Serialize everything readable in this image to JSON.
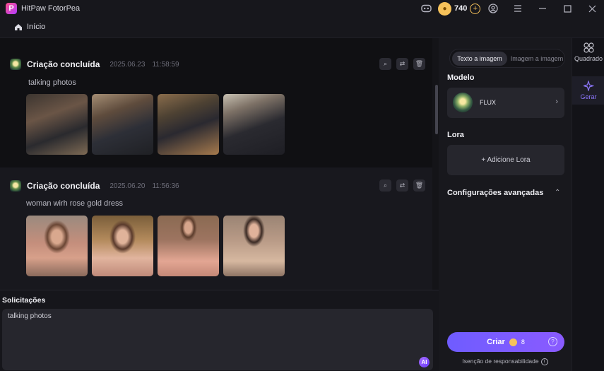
{
  "app": {
    "logo_letter": "P",
    "title": "HitPaw FotorPea"
  },
  "titlebar": {
    "coin_count": "740"
  },
  "breadcrumb": {
    "home_label": "Início"
  },
  "history": [
    {
      "title": "Criação concluída",
      "date": "2025.06.23",
      "time": "11:58:59",
      "prompt": "talking photos"
    },
    {
      "title": "Criação concluída",
      "date": "2025.06.20",
      "time": "11:56:36",
      "prompt": "woman wirh rose gold dress"
    }
  ],
  "prompt_panel": {
    "label": "Solicitações",
    "value": "talking photos",
    "ai_badge": "AI"
  },
  "settings": {
    "tabs": [
      "Texto a imagem",
      "Imagem a imagem"
    ],
    "model_label": "Modelo",
    "model_name": "FLUX",
    "lora_label": "Lora",
    "add_lora": "+ Adicione Lora",
    "advanced_label": "Configurações avançadas",
    "create_label": "Criar",
    "create_cost": "8",
    "disclaimer": "Isenção de responsabilidade"
  },
  "rail": {
    "items": [
      "Quadrado",
      "Gerar"
    ]
  },
  "colors": {
    "accent": "#7b5cff",
    "coin": "#f6c25a"
  }
}
